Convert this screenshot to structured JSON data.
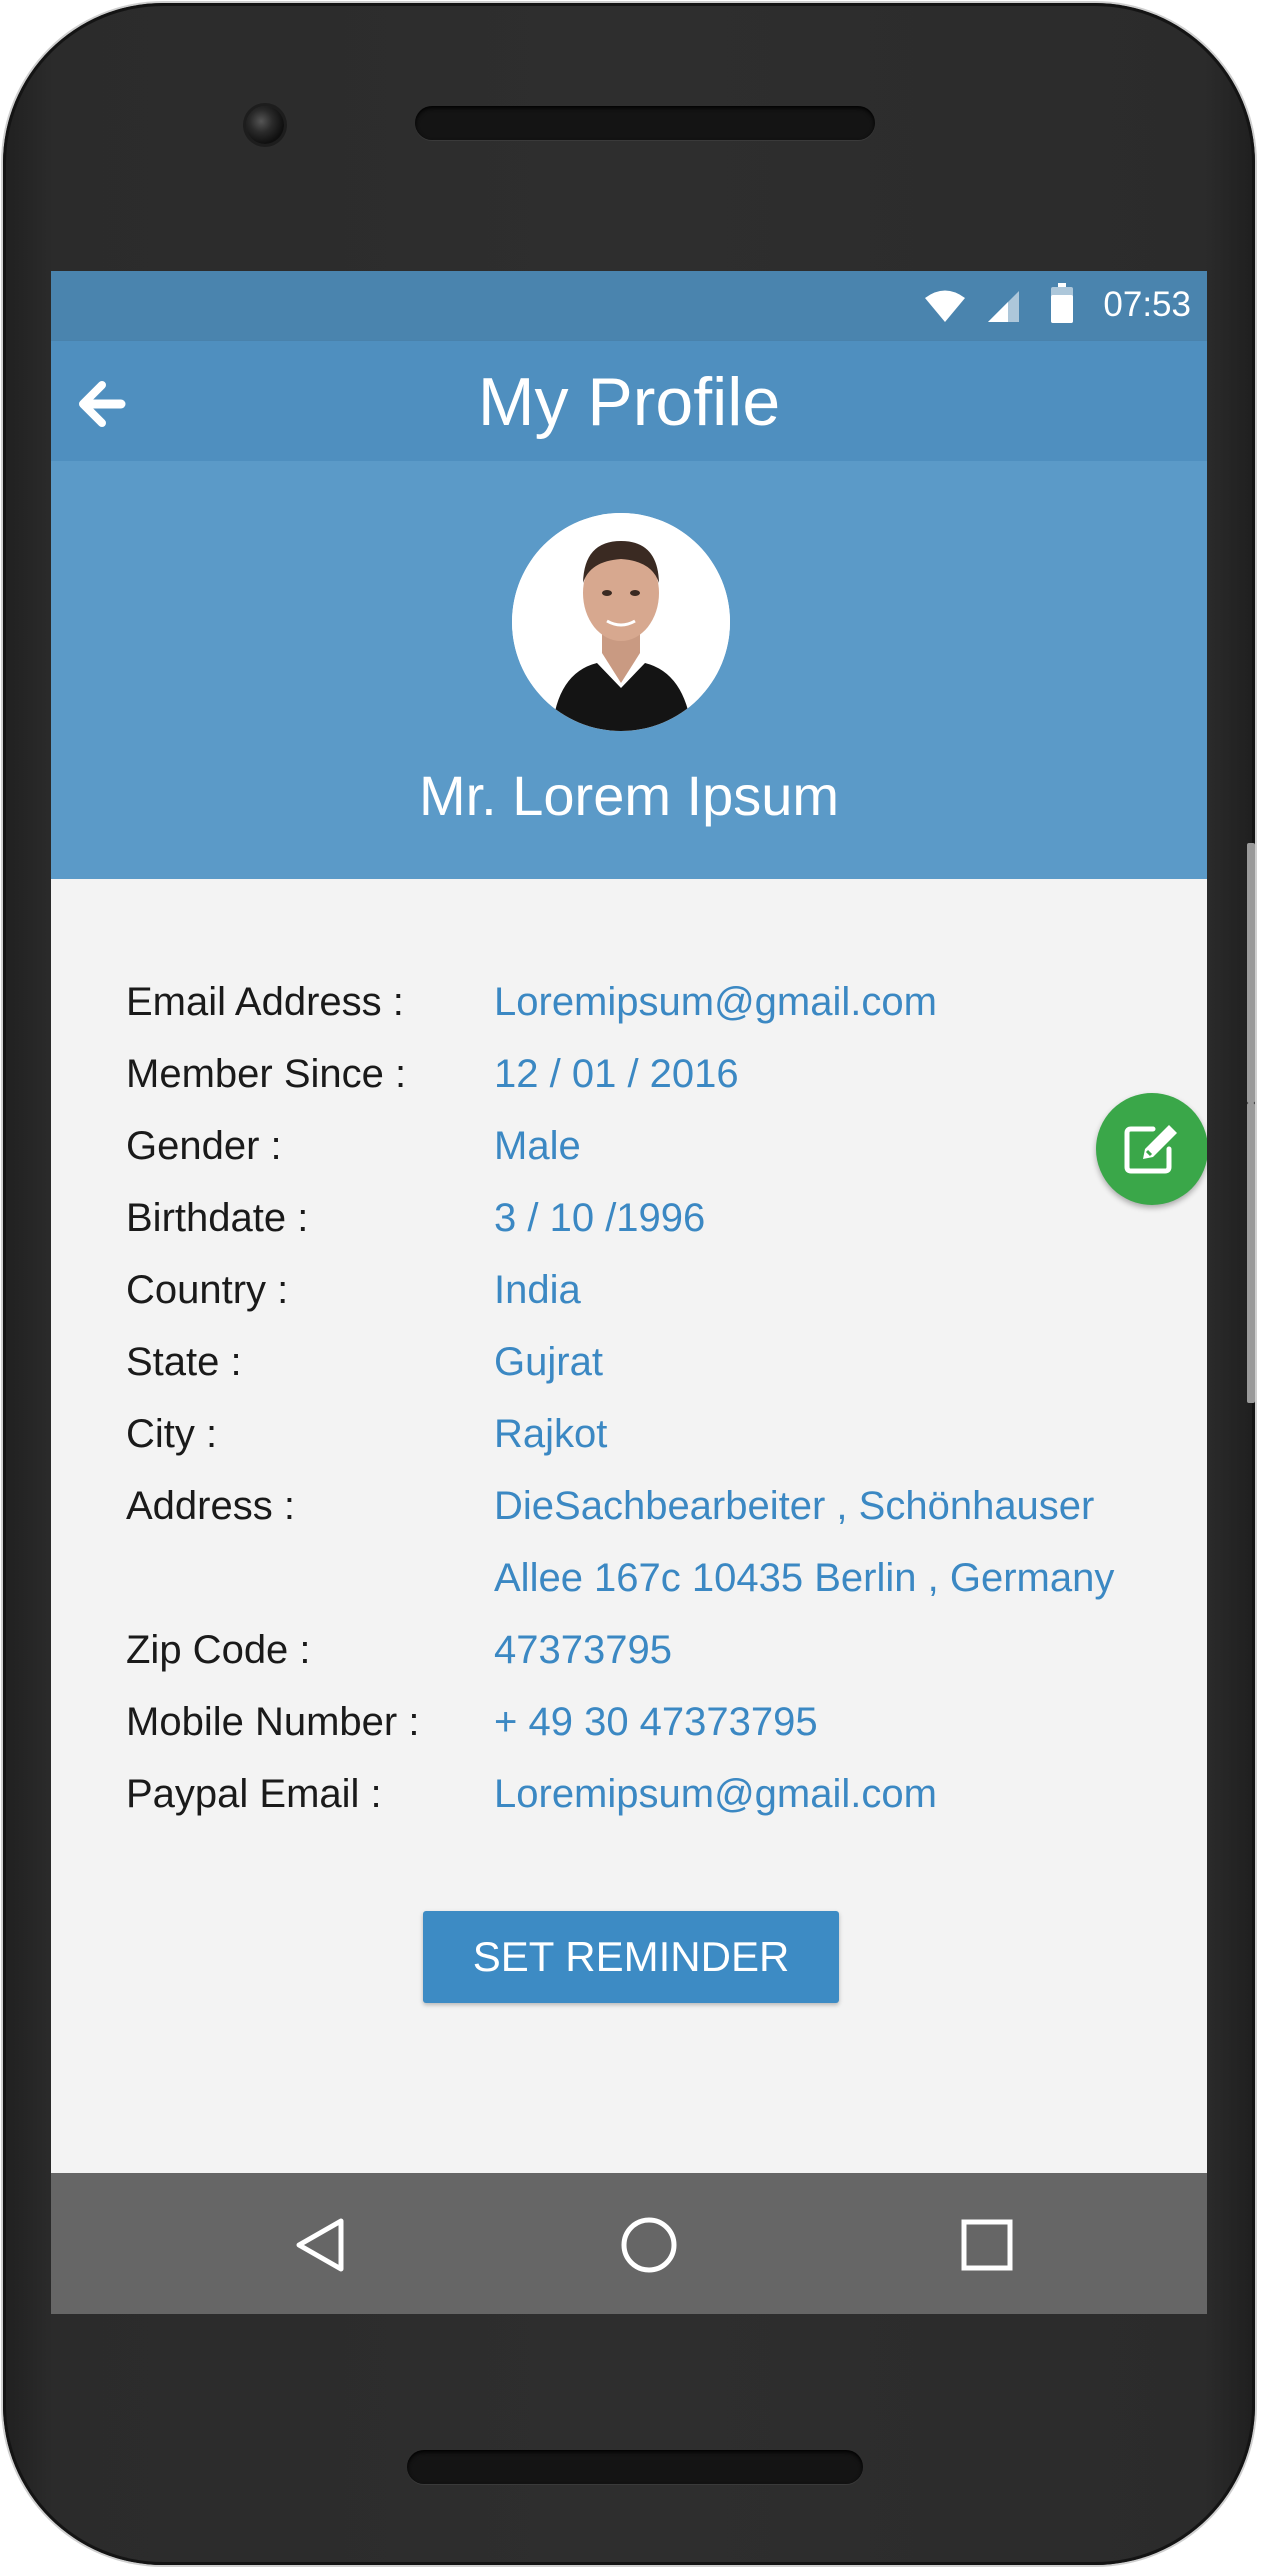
{
  "status_bar": {
    "time": "07:53"
  },
  "app_bar": {
    "title": "My Profile"
  },
  "profile": {
    "name": "Mr. Lorem Ipsum"
  },
  "details": [
    {
      "label": "Email Address :",
      "value": "Loremipsum@gmail.com"
    },
    {
      "label": "Member Since :",
      "value": "12 / 01 / 2016"
    },
    {
      "label": "Gender :",
      "value": "Male"
    },
    {
      "label": "Birthdate :",
      "value": "3 / 10 /1996"
    },
    {
      "label": "Country :",
      "value": "India"
    },
    {
      "label": "State :",
      "value": "Gujrat"
    },
    {
      "label": "City :",
      "value": "Rajkot"
    },
    {
      "label": "Address :",
      "value": "DieSachbearbeiter , Schönhauser Allee 167c 10435 Berlin , Germany"
    },
    {
      "label": "Zip Code :",
      "value": "47373795"
    },
    {
      "label": "Mobile Number :",
      "value": "+ 49 30 47373795"
    },
    {
      "label": "Paypal Email :",
      "value": "Loremipsum@gmail.com"
    }
  ],
  "actions": {
    "set_reminder": "SET REMINDER"
  },
  "icons": {
    "back": "arrow-left-icon",
    "edit": "edit-pencil-icon",
    "wifi": "wifi-icon",
    "signal": "signal-icon",
    "battery": "battery-icon",
    "nav_back": "triangle-back-icon",
    "nav_home": "circle-home-icon",
    "nav_recents": "square-recents-icon"
  },
  "colors": {
    "status_bar": "#4a84ae",
    "app_bar": "#4f8fbf",
    "header": "#5b9ac8",
    "value_text": "#3b88c3",
    "fab": "#3aa749",
    "button": "#3d8bc4"
  }
}
